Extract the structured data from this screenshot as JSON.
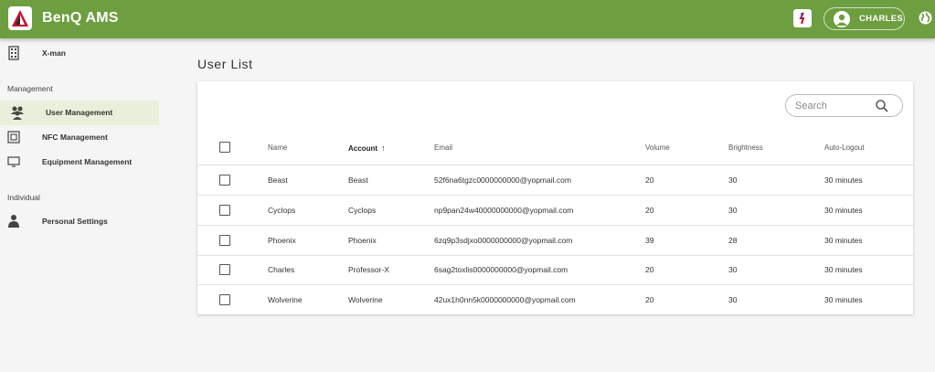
{
  "header": {
    "app_title": "BenQ AMS",
    "user_name": "CHARLES",
    "brand_color": "#6d9e3f"
  },
  "sidebar": {
    "top_item": {
      "label": "X-man",
      "icon": "building-icon"
    },
    "sections": [
      {
        "title": "Management"
      },
      {
        "title": "Individual"
      }
    ],
    "items": [
      {
        "label": "User Management",
        "icon": "users-icon",
        "active": true
      },
      {
        "label": "NFC Management",
        "icon": "nfc-icon"
      },
      {
        "label": "Equipment Management",
        "icon": "monitor-icon"
      },
      {
        "label": "Personal Settings",
        "icon": "person-icon"
      }
    ]
  },
  "main": {
    "title": "User List",
    "search": {
      "placeholder": "Search",
      "value": ""
    },
    "table": {
      "columns": [
        "Name",
        "Account",
        "Email",
        "Volume",
        "Brightness",
        "Auto-Logout"
      ],
      "sorted_column": "Account",
      "sort_direction": "ascending",
      "rows": [
        {
          "name": "Beast",
          "account": "Beast",
          "email": "52f6na6tgzc0000000000@yopmail.com",
          "volume": "20",
          "brightness": "30",
          "auto_logout": "30 minutes"
        },
        {
          "name": "Cyclops",
          "account": "Cyclops",
          "email": "np9pan24w40000000000@yopmail.com",
          "volume": "20",
          "brightness": "30",
          "auto_logout": "30 minutes"
        },
        {
          "name": "Phoenix",
          "account": "Phoenix",
          "email": "6zq9p3sdjxo0000000000@yopmail.com",
          "volume": "39",
          "brightness": "28",
          "auto_logout": "30 minutes"
        },
        {
          "name": "Charles",
          "account": "Professor-X",
          "email": "6sag2toxlis0000000000@yopmail.com",
          "volume": "20",
          "brightness": "30",
          "auto_logout": "30 minutes"
        },
        {
          "name": "Wolverine",
          "account": "Wolverine",
          "email": "42ux1h0nn5k0000000000@yopmail.com",
          "volume": "20",
          "brightness": "30",
          "auto_logout": "30 minutes"
        }
      ]
    }
  }
}
